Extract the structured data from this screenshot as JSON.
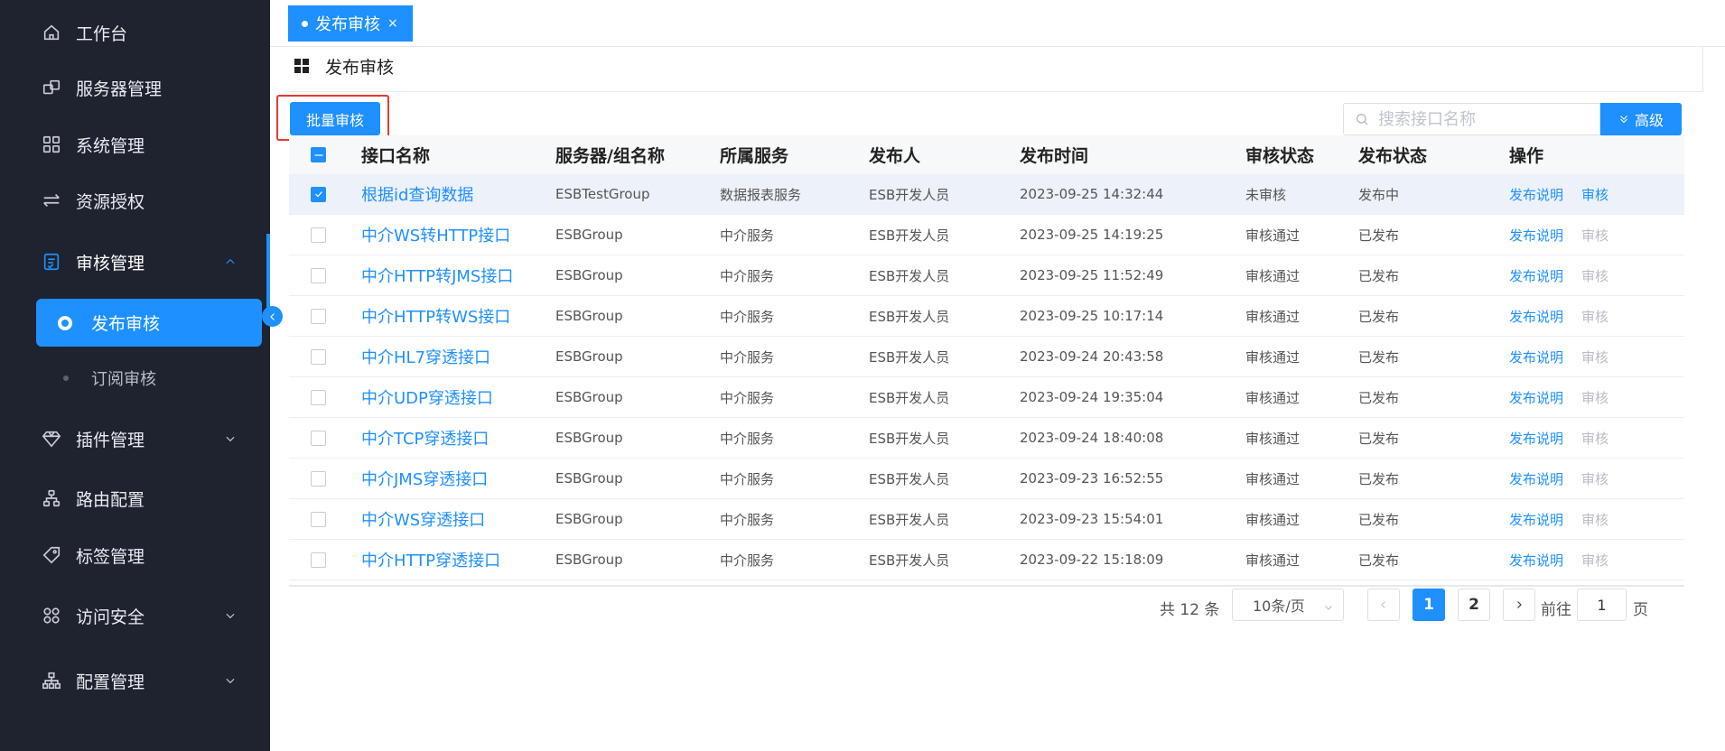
{
  "sidebar": {
    "items": [
      {
        "label": "工作台",
        "icon": "home-icon"
      },
      {
        "label": "服务器管理",
        "icon": "server-icon"
      },
      {
        "label": "系统管理",
        "icon": "apps-icon"
      },
      {
        "label": "资源授权",
        "icon": "transfer-icon"
      },
      {
        "label": "审核管理",
        "icon": "audit-icon",
        "open": true
      },
      {
        "label": "插件管理",
        "icon": "diamond-icon"
      },
      {
        "label": "路由配置",
        "icon": "route-icon"
      },
      {
        "label": "标签管理",
        "icon": "tag-icon"
      },
      {
        "label": "访问安全",
        "icon": "security-icon"
      },
      {
        "label": "配置管理",
        "icon": "sitemap-icon"
      }
    ],
    "sub_items": [
      {
        "label": "发布审核",
        "active": true
      },
      {
        "label": "订阅审核"
      }
    ]
  },
  "tabs": [
    {
      "label": "发布审核",
      "close": "×"
    }
  ],
  "page": {
    "title": "发布审核"
  },
  "toolbar": {
    "batch_label": "批量审核",
    "search_placeholder": "搜索接口名称",
    "advanced_label": "高级"
  },
  "table": {
    "headers": {
      "name": "接口名称",
      "group": "服务器/组名称",
      "service": "所属服务",
      "publisher": "发布人",
      "time": "发布时间",
      "audit": "审核状态",
      "state": "发布状态",
      "ops": "操作"
    },
    "rows": [
      {
        "name": "根据id查询数据",
        "group": "ESBTestGroup",
        "service": "数据报表服务",
        "publisher": "ESB开发人员",
        "time": "2023-09-25 14:32:44",
        "audit": "未审核",
        "state": "发布中",
        "op1": "发布说明",
        "op2": "审核",
        "checked": true
      },
      {
        "name": "中介WS转HTTP接口",
        "group": "ESBGroup",
        "service": "中介服务",
        "publisher": "ESB开发人员",
        "time": "2023-09-25 14:19:25",
        "audit": "审核通过",
        "state": "已发布",
        "op1": "发布说明",
        "op2": "审核"
      },
      {
        "name": "中介HTTP转JMS接口",
        "group": "ESBGroup",
        "service": "中介服务",
        "publisher": "ESB开发人员",
        "time": "2023-09-25 11:52:49",
        "audit": "审核通过",
        "state": "已发布",
        "op1": "发布说明",
        "op2": "审核"
      },
      {
        "name": "中介HTTP转WS接口",
        "group": "ESBGroup",
        "service": "中介服务",
        "publisher": "ESB开发人员",
        "time": "2023-09-25 10:17:14",
        "audit": "审核通过",
        "state": "已发布",
        "op1": "发布说明",
        "op2": "审核"
      },
      {
        "name": "中介HL7穿透接口",
        "group": "ESBGroup",
        "service": "中介服务",
        "publisher": "ESB开发人员",
        "time": "2023-09-24 20:43:58",
        "audit": "审核通过",
        "state": "已发布",
        "op1": "发布说明",
        "op2": "审核"
      },
      {
        "name": "中介UDP穿透接口",
        "group": "ESBGroup",
        "service": "中介服务",
        "publisher": "ESB开发人员",
        "time": "2023-09-24 19:35:04",
        "audit": "审核通过",
        "state": "已发布",
        "op1": "发布说明",
        "op2": "审核"
      },
      {
        "name": "中介TCP穿透接口",
        "group": "ESBGroup",
        "service": "中介服务",
        "publisher": "ESB开发人员",
        "time": "2023-09-24 18:40:08",
        "audit": "审核通过",
        "state": "已发布",
        "op1": "发布说明",
        "op2": "审核"
      },
      {
        "name": "中介JMS穿透接口",
        "group": "ESBGroup",
        "service": "中介服务",
        "publisher": "ESB开发人员",
        "time": "2023-09-23 16:52:55",
        "audit": "审核通过",
        "state": "已发布",
        "op1": "发布说明",
        "op2": "审核"
      },
      {
        "name": "中介WS穿透接口",
        "group": "ESBGroup",
        "service": "中介服务",
        "publisher": "ESB开发人员",
        "time": "2023-09-23 15:54:01",
        "audit": "审核通过",
        "state": "已发布",
        "op1": "发布说明",
        "op2": "审核"
      },
      {
        "name": "中介HTTP穿透接口",
        "group": "ESBGroup",
        "service": "中介服务",
        "publisher": "ESB开发人员",
        "time": "2023-09-22 15:18:09",
        "audit": "审核通过",
        "state": "已发布",
        "op1": "发布说明",
        "op2": "审核"
      }
    ]
  },
  "pagination": {
    "total": "共 12 条",
    "page_size": "10条/页",
    "pages": [
      "1",
      "2"
    ],
    "current": "1",
    "goto_label": "前往",
    "goto_value": "1",
    "page_suffix": "页"
  },
  "colors": {
    "accent": "#1e90ff",
    "sidebar_bg": "#1f2330",
    "highlight_box": "#e53935"
  }
}
